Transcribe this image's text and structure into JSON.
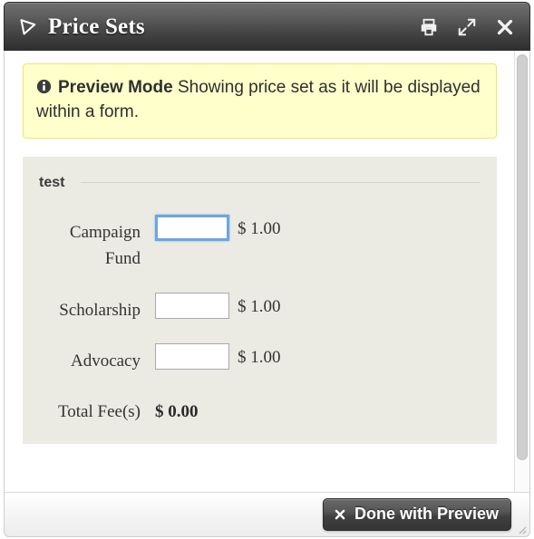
{
  "window": {
    "title": "Price Sets",
    "logo_icon": "triangle-play-icon",
    "actions": [
      {
        "name": "print",
        "icon": "printer-icon",
        "label": "Print"
      },
      {
        "name": "maximize",
        "icon": "expand-arrows-icon",
        "label": "Maximize"
      },
      {
        "name": "close",
        "icon": "close-x-icon",
        "label": "Close"
      }
    ]
  },
  "notice": {
    "icon": "info-icon",
    "strong": "Preview Mode",
    "text": " Showing price set as it will be displayed within a form.",
    "background_color": "#ffffcc",
    "border_color": "#e8e86b"
  },
  "price_set": {
    "title": "test",
    "fields": [
      {
        "label": "Campaign Fund",
        "value": "",
        "amount": "$ 1.00",
        "focused": true
      },
      {
        "label": "Scholarship",
        "value": "",
        "amount": "$ 1.00",
        "focused": false
      },
      {
        "label": "Advocacy",
        "value": "",
        "amount": "$ 1.00",
        "focused": false
      }
    ],
    "total_label": "Total Fee(s)",
    "total_value": "$ 0.00",
    "panel_color": "#ebebe3",
    "focus_color": "#6aa6e0"
  },
  "footer": {
    "done_button_label": "Done with Preview",
    "done_button_icon": "close-x-icon"
  },
  "scrollbar": {
    "name": "vertical-scrollbar"
  }
}
